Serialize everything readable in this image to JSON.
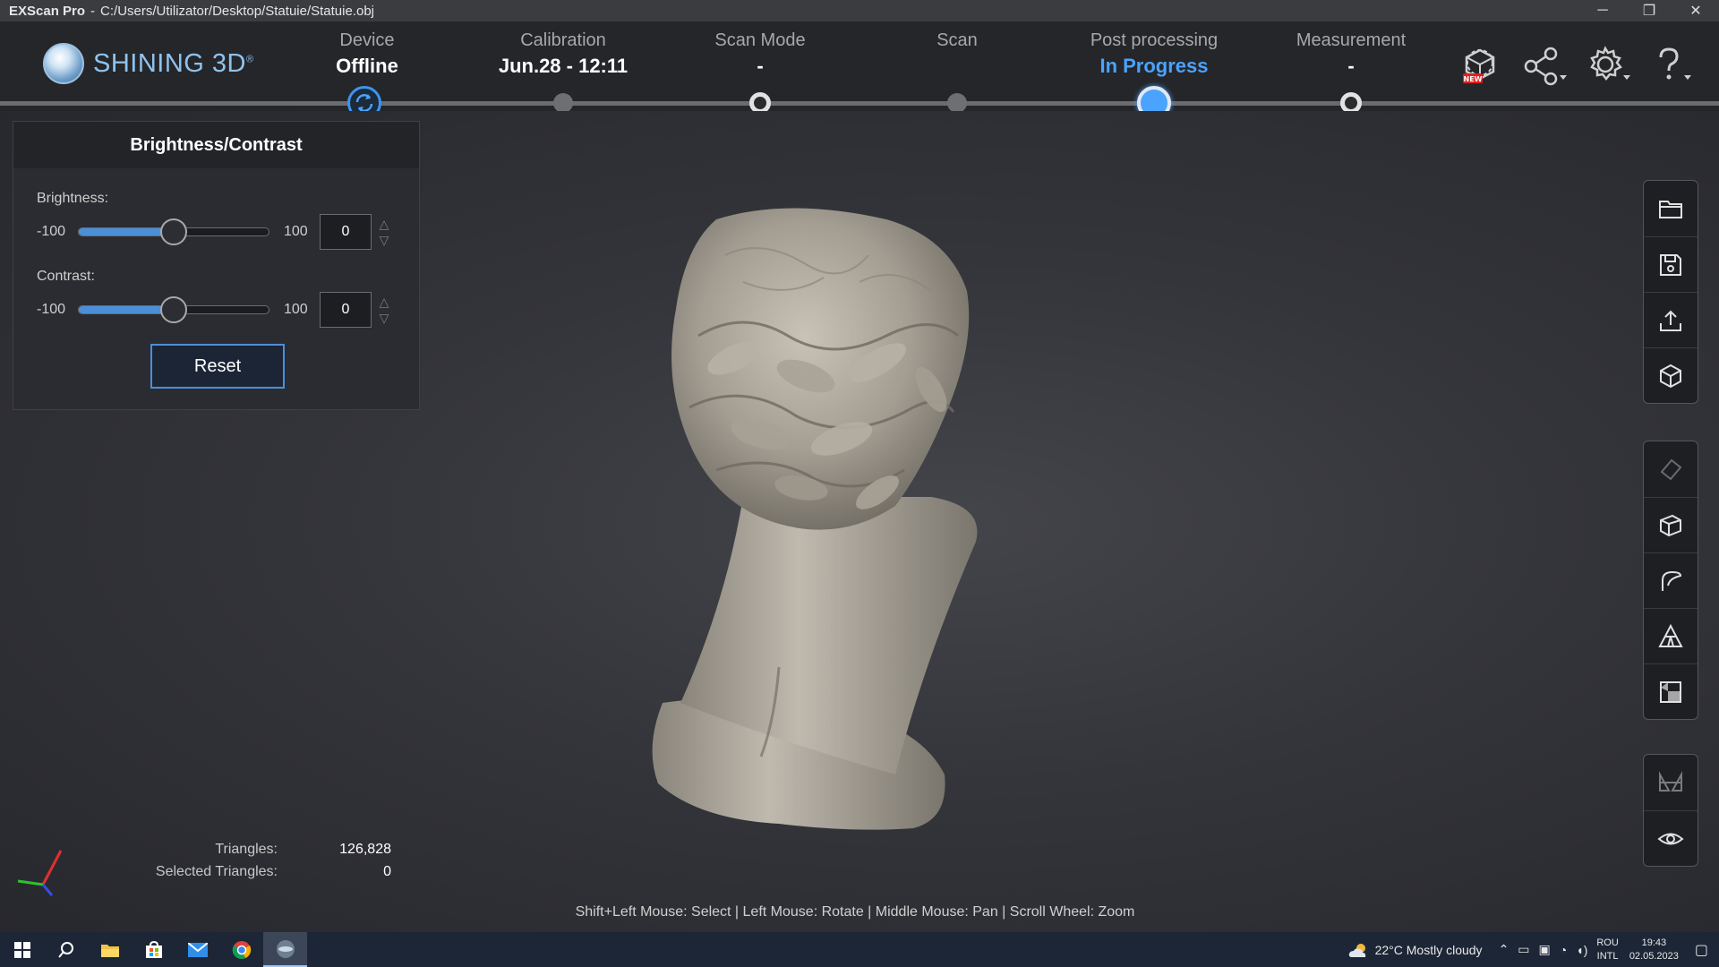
{
  "window": {
    "app_name": "EXScan Pro",
    "separator": "-",
    "file_path": "C:/Users/Utilizator/Desktop/Statuie/Statuie.obj",
    "minimize": "─",
    "restore": "❐",
    "close": "✕"
  },
  "brand": {
    "name": "SHINING 3D",
    "reg": "®"
  },
  "steps": [
    {
      "label": "Device",
      "value": "Offline"
    },
    {
      "label": "Calibration",
      "value": "Jun.28 - 12:11"
    },
    {
      "label": "Scan Mode",
      "value": "-"
    },
    {
      "label": "Scan",
      "value": ""
    },
    {
      "label": "Post processing",
      "value": "In Progress"
    },
    {
      "label": "Measurement",
      "value": "-"
    }
  ],
  "header_icons": [
    "new-model-icon",
    "share-icon",
    "settings-icon",
    "help-icon"
  ],
  "new_badge": "NEW",
  "panel": {
    "title": "Brightness/Contrast",
    "brightness": {
      "label": "Brightness:",
      "min": "-100",
      "max": "100",
      "value": "0",
      "level": 0.5
    },
    "contrast": {
      "label": "Contrast:",
      "min": "-100",
      "max": "100",
      "value": "0",
      "level": 0.5
    },
    "reset": "Reset"
  },
  "toolbar": {
    "file_group": [
      "folder-icon",
      "save-icon",
      "export-icon",
      "cube-icon"
    ],
    "edit_group": [
      "eraser-icon",
      "box-select-icon",
      "lasso-icon",
      "triangle-mesh-icon",
      "clip-box-icon"
    ],
    "view_group": [
      "mirror-icon",
      "eye-icon"
    ]
  },
  "stats": {
    "triangles_label": "Triangles:",
    "triangles_value": "126,828",
    "selected_label": "Selected Triangles:",
    "selected_value": "0"
  },
  "hint": "Shift+Left Mouse: Select | Left Mouse: Rotate | Middle Mouse: Pan | Scroll Wheel: Zoom",
  "taskbar": {
    "weather": "22°C  Mostly cloudy",
    "lang_top": "ROU",
    "lang_bottom": "INTL",
    "time": "19:43",
    "date": "02.05.2023"
  },
  "colors": {
    "accent": "#4aa3ff",
    "header_bg": "#25262a",
    "taskbar_bg": "#1c2636"
  }
}
